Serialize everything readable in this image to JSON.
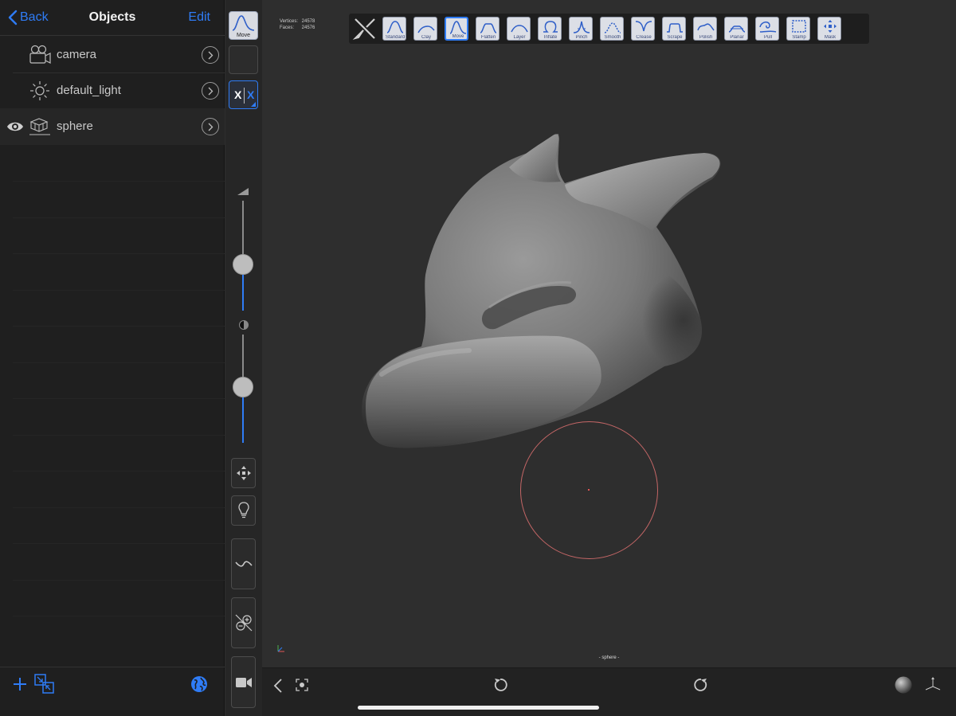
{
  "nav": {
    "back_label": "Back",
    "title": "Objects",
    "edit_label": "Edit"
  },
  "objects": [
    {
      "name": "camera",
      "icon": "camera-icon",
      "visible": false
    },
    {
      "name": "default_light",
      "icon": "sun-icon",
      "visible": false
    },
    {
      "name": "sphere",
      "icon": "mesh-icon",
      "visible": true
    }
  ],
  "tools": {
    "active_tool_label": "Move",
    "symmetry": {
      "x_label": "X",
      "x2_label": "X"
    }
  },
  "sliders": {
    "radius": {
      "value": 0.4
    },
    "intensity": {
      "value": 0.5
    }
  },
  "stats": {
    "vertices_label": "Vertices:",
    "vertices_value": "24578",
    "faces_label": "Faces:",
    "faces_value": "24576"
  },
  "brushes": [
    {
      "label": "Standard",
      "active": false
    },
    {
      "label": "Clay",
      "active": false
    },
    {
      "label": "Move",
      "active": true
    },
    {
      "label": "Flatten",
      "active": false
    },
    {
      "label": "Layer",
      "active": false
    },
    {
      "label": "Inflate",
      "active": false
    },
    {
      "label": "Pinch",
      "active": false
    },
    {
      "label": "Smooth",
      "active": false
    },
    {
      "label": "Crease",
      "active": false
    },
    {
      "label": "Scrape",
      "active": false
    },
    {
      "label": "Polish",
      "active": false
    },
    {
      "label": "Planar",
      "active": false
    },
    {
      "label": "Pull",
      "active": false
    },
    {
      "label": "Stamp",
      "active": false
    },
    {
      "label": "Mask",
      "active": false
    }
  ],
  "viewport": {
    "object_name": "- sphere -"
  },
  "colors": {
    "accent": "#2f7cf6",
    "panel_bg": "#1f1f1f",
    "viewport_bg": "#2e2e2e",
    "brush_cursor": "#c46666"
  }
}
